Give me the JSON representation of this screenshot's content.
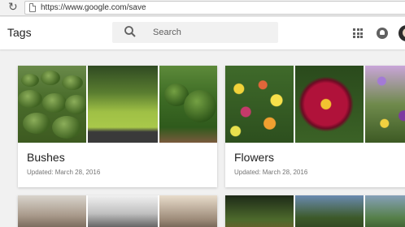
{
  "browser": {
    "url": "https://www.google.com/save",
    "reload_icon": "reload-icon",
    "page_icon": "page-icon"
  },
  "header": {
    "title": "Tags",
    "search": {
      "placeholder": "Search",
      "icon": "search-icon"
    },
    "apps_icon": "apps-grid-icon",
    "notifications_icon": "notifications-icon",
    "avatar": "account-avatar"
  },
  "cards": [
    {
      "title": "Bushes",
      "updated": "Updated: March 28, 2016"
    },
    {
      "title": "Flowers",
      "updated": "Updated: March 28, 2016"
    }
  ],
  "colors": {
    "page_bg": "#f1f1f1",
    "card_bg": "#ffffff",
    "title_text": "#212121",
    "meta_text": "#757575"
  }
}
